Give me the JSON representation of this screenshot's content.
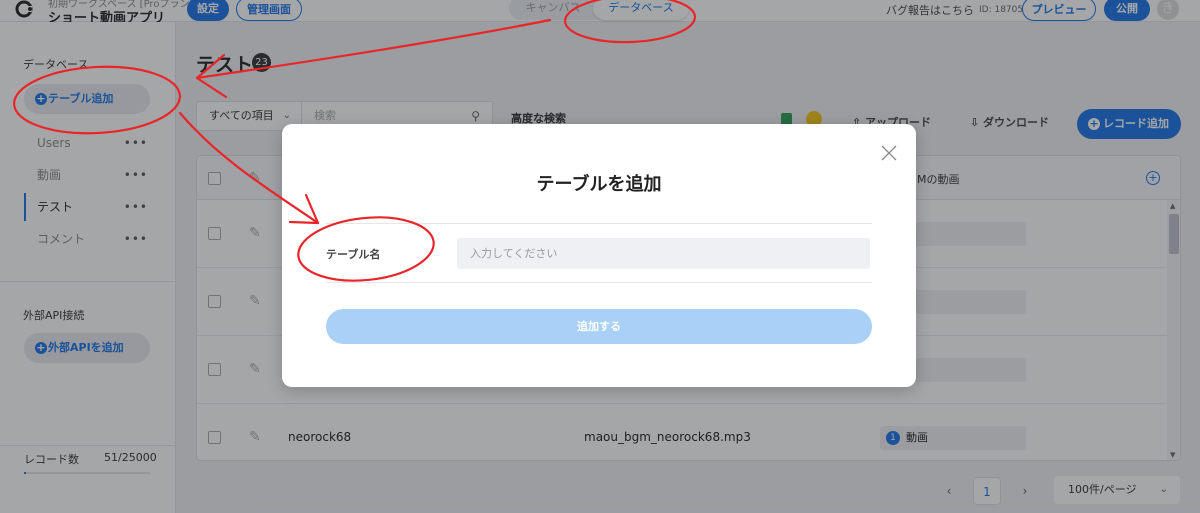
{
  "header": {
    "workspace_label": "初期ワークスペース [Proプラン]",
    "app_name": "ショート動画アプリ",
    "settings_label": "設定",
    "admin_label": "管理画面",
    "mode_canvas": "キャンバス",
    "mode_database": "データベース",
    "bug_report": "バグ報告はこちら",
    "app_id": "ID: 18705",
    "preview_label": "プレビュー",
    "publish_label": "公開",
    "avatar_initial": "き"
  },
  "sidebar": {
    "db_heading": "データベース",
    "add_table_label": "テーブル追加",
    "tables": [
      {
        "label": "Users"
      },
      {
        "label": "動画"
      },
      {
        "label": "テスト",
        "active": true
      },
      {
        "label": "コメント"
      }
    ],
    "more_glyph": "•••",
    "api_heading": "外部API接続",
    "add_api_label": "外部APIを追加",
    "record_label": "レコード数",
    "record_count": "51/25000",
    "record_fraction": 0.002
  },
  "main": {
    "title": "テスト",
    "count": "23",
    "filter_label": "すべての項目",
    "search_placeholder": "検索",
    "advanced_search": "高度な検索",
    "upload_label": "アップロード",
    "download_label": "ダウンロード",
    "add_record_label": "レコード追加",
    "column_partial": "Mの動画",
    "rows": [
      {
        "name": "",
        "file": "",
        "tag_num": "",
        "tag": "画"
      },
      {
        "name": "",
        "file": "",
        "tag_num": "",
        "tag": "画"
      },
      {
        "name": "",
        "file": "",
        "tag_num": "",
        "tag": "画"
      },
      {
        "name": "neorock68",
        "file": "maou_bgm_neorock68.mp3",
        "tag_num": "1",
        "tag": "動画"
      }
    ],
    "pager_prev": "‹",
    "pager_page": "1",
    "pager_next": "›",
    "per_page": "100件/ページ"
  },
  "modal": {
    "title": "テーブルを追加",
    "field_label": "テーブル名",
    "field_placeholder": "入力してください",
    "field_value": "",
    "submit_label": "追加する"
  },
  "colors": {
    "accent": "#1a73e8",
    "annotation": "#e8262a",
    "submit_disabled": "#a9d0f7"
  }
}
